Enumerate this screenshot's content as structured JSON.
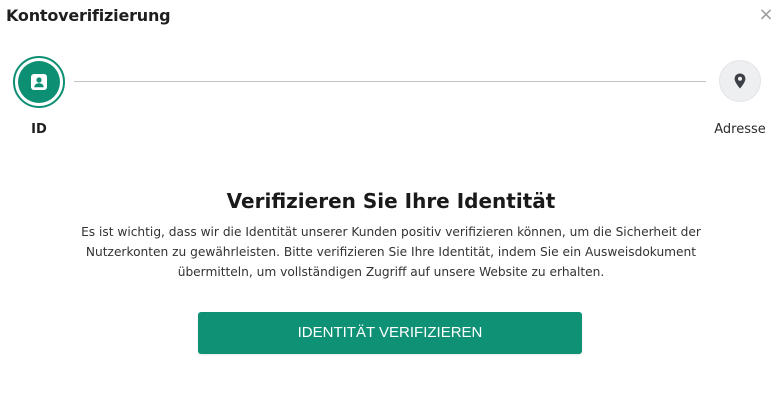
{
  "dialog": {
    "title": "Kontoverifizierung",
    "close_symbol": "×"
  },
  "stepper": {
    "steps": [
      {
        "label": "ID",
        "icon": "id-card-icon",
        "state": "active"
      },
      {
        "label": "Adresse",
        "icon": "map-pin-icon",
        "state": "inactive"
      }
    ]
  },
  "content": {
    "heading": "Verifizieren Sie Ihre Identität",
    "description": "Es ist wichtig, dass wir die Identität unserer Kunden positiv verifizieren können, um die Sicherheit der Nutzerkonten zu gewährleisten. Bitte verifizieren Sie Ihre Identität, indem Sie ein Ausweisdokument übermitteln, um vollständigen Zugriff auf unsere Website zu erhalten.",
    "button_label": "IDENTITÄT VERIFIZIEREN"
  },
  "colors": {
    "accent": "#0f9176",
    "inactive_step": "#eeeff1",
    "line": "#c4c4c4"
  }
}
